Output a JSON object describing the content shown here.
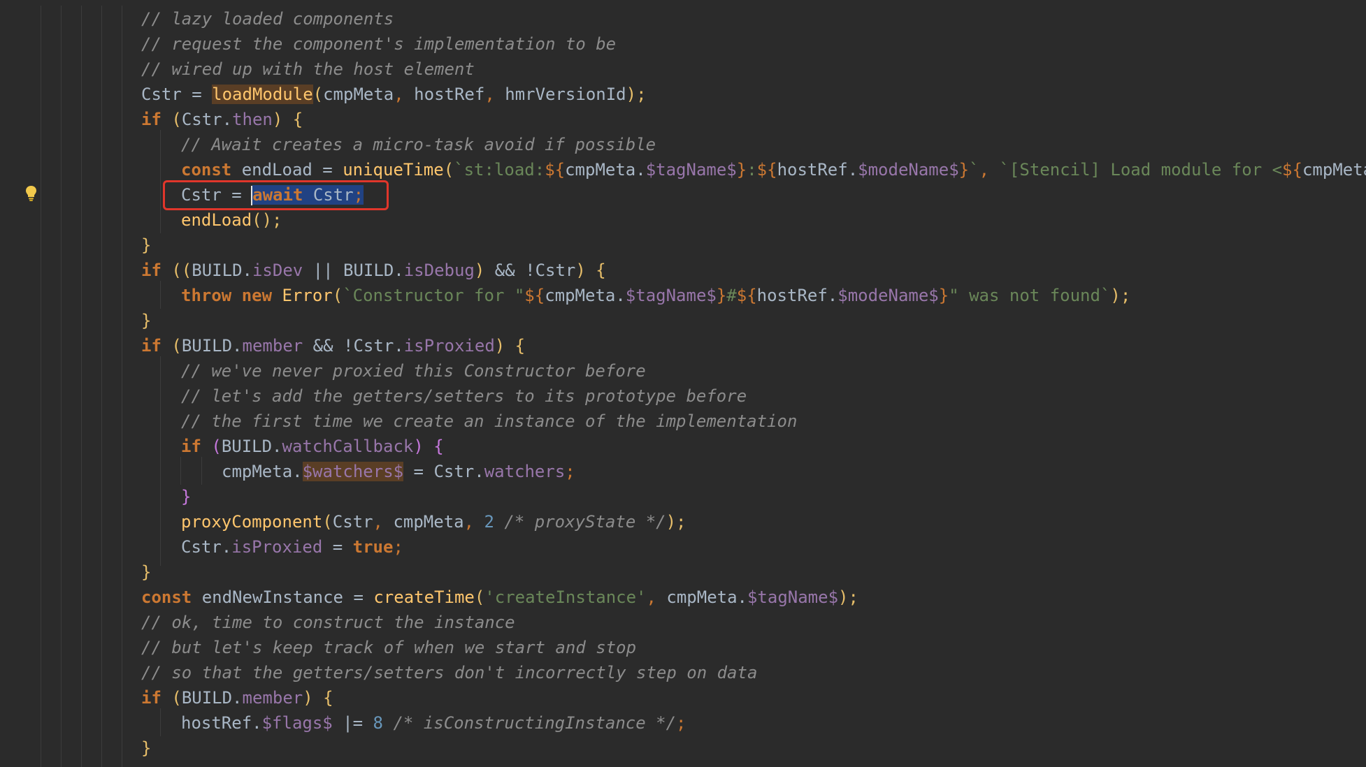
{
  "editor": {
    "gutter": {
      "lightbulb_icon": "lightbulb-icon"
    },
    "annotation": {
      "color": "#e0362b"
    },
    "lines": [
      {
        "tokens": [
          {
            "text": "// lazy loaded components",
            "cls": "c-comment"
          }
        ]
      },
      {
        "tokens": [
          {
            "text": "// request the component's implementation to be",
            "cls": "c-comment"
          }
        ]
      },
      {
        "tokens": [
          {
            "text": "// wired up with the host element",
            "cls": "c-comment"
          }
        ]
      },
      {
        "tokens": [
          {
            "text": "Cstr = ",
            "cls": "c-ident"
          },
          {
            "text": "loadModule",
            "cls": "c-func hl-func"
          },
          {
            "text": "(",
            "cls": "c-paren"
          },
          {
            "text": "cmpMeta",
            "cls": "c-ident"
          },
          {
            "text": ", ",
            "cls": "c-punct"
          },
          {
            "text": "hostRef",
            "cls": "c-ident"
          },
          {
            "text": ", ",
            "cls": "c-punct"
          },
          {
            "text": "hmrVersionId",
            "cls": "c-ident"
          },
          {
            "text": ");",
            "cls": "c-paren"
          }
        ]
      },
      {
        "tokens": [
          {
            "text": "if ",
            "cls": "c-keyword"
          },
          {
            "text": "(",
            "cls": "c-paren"
          },
          {
            "text": "Cstr.",
            "cls": "c-ident"
          },
          {
            "text": "then",
            "cls": "c-prop"
          },
          {
            "text": ") {",
            "cls": "c-paren"
          }
        ]
      },
      {
        "tokens": [
          {
            "text": "// Await creates a micro-task avoid if possible",
            "cls": "c-comment"
          }
        ]
      },
      {
        "tokens": [
          {
            "text": "const ",
            "cls": "c-keyword"
          },
          {
            "text": "endLoad = ",
            "cls": "c-ident"
          },
          {
            "text": "uniqueTime",
            "cls": "c-func"
          },
          {
            "text": "(",
            "cls": "c-paren"
          },
          {
            "text": "`st:load:",
            "cls": "c-string"
          },
          {
            "text": "${",
            "cls": "c-tpl"
          },
          {
            "text": "cmpMeta.",
            "cls": "c-ident"
          },
          {
            "text": "$tagName$",
            "cls": "c-prop"
          },
          {
            "text": "}",
            "cls": "c-tpl"
          },
          {
            "text": ":",
            "cls": "c-string"
          },
          {
            "text": "${",
            "cls": "c-tpl"
          },
          {
            "text": "hostRef.",
            "cls": "c-ident"
          },
          {
            "text": "$modeName$",
            "cls": "c-prop"
          },
          {
            "text": "}",
            "cls": "c-tpl"
          },
          {
            "text": "`",
            "cls": "c-string"
          },
          {
            "text": ", ",
            "cls": "c-punct"
          },
          {
            "text": "`[Stencil] Load module for <",
            "cls": "c-string"
          },
          {
            "text": "${",
            "cls": "c-tpl"
          },
          {
            "text": "cmpMeta",
            "cls": "c-ident"
          }
        ]
      },
      {
        "tokens": [
          {
            "text": "Cstr = ",
            "cls": "c-ident"
          },
          {
            "text": "|",
            "cls": "caret"
          },
          {
            "text": "await",
            "cls": "c-keyword hl-sel"
          },
          {
            "text": " Cstr",
            "cls": "c-ident hl-sel"
          },
          {
            "text": ";",
            "cls": "c-punct hl-sel"
          }
        ]
      },
      {
        "tokens": [
          {
            "text": "endLoad",
            "cls": "c-func"
          },
          {
            "text": "();",
            "cls": "c-paren"
          }
        ]
      },
      {
        "tokens": [
          {
            "text": "}",
            "cls": "c-paren"
          }
        ]
      },
      {
        "tokens": [
          {
            "text": "if ",
            "cls": "c-keyword"
          },
          {
            "text": "((",
            "cls": "c-paren"
          },
          {
            "text": "BUILD.",
            "cls": "c-ident"
          },
          {
            "text": "isDev",
            "cls": "c-prop"
          },
          {
            "text": " || ",
            "cls": "c-ident"
          },
          {
            "text": "BUILD.",
            "cls": "c-ident"
          },
          {
            "text": "isDebug",
            "cls": "c-prop"
          },
          {
            "text": ")",
            "cls": "c-paren"
          },
          {
            "text": " && !Cstr",
            "cls": "c-ident"
          },
          {
            "text": ") {",
            "cls": "c-paren"
          }
        ]
      },
      {
        "tokens": [
          {
            "text": "throw ",
            "cls": "c-keyword"
          },
          {
            "text": "new ",
            "cls": "c-keyword"
          },
          {
            "text": "Error",
            "cls": "c-func"
          },
          {
            "text": "(",
            "cls": "c-paren"
          },
          {
            "text": "`Constructor for \"",
            "cls": "c-string"
          },
          {
            "text": "${",
            "cls": "c-tpl"
          },
          {
            "text": "cmpMeta.",
            "cls": "c-ident"
          },
          {
            "text": "$tagName$",
            "cls": "c-prop"
          },
          {
            "text": "}",
            "cls": "c-tpl"
          },
          {
            "text": "#",
            "cls": "c-string"
          },
          {
            "text": "${",
            "cls": "c-tpl"
          },
          {
            "text": "hostRef.",
            "cls": "c-ident"
          },
          {
            "text": "$modeName$",
            "cls": "c-prop"
          },
          {
            "text": "}",
            "cls": "c-tpl"
          },
          {
            "text": "\" was not found`",
            "cls": "c-string"
          },
          {
            "text": ");",
            "cls": "c-paren"
          }
        ]
      },
      {
        "tokens": [
          {
            "text": "}",
            "cls": "c-paren"
          }
        ]
      },
      {
        "tokens": [
          {
            "text": "if ",
            "cls": "c-keyword"
          },
          {
            "text": "(",
            "cls": "c-paren"
          },
          {
            "text": "BUILD.",
            "cls": "c-ident"
          },
          {
            "text": "member",
            "cls": "c-prop"
          },
          {
            "text": " && !Cstr.",
            "cls": "c-ident"
          },
          {
            "text": "isProxied",
            "cls": "c-prop"
          },
          {
            "text": ") {",
            "cls": "c-paren"
          }
        ]
      },
      {
        "tokens": [
          {
            "text": "// we've never proxied this Constructor before",
            "cls": "c-comment"
          }
        ]
      },
      {
        "tokens": [
          {
            "text": "// let's add the getters/setters to its prototype before",
            "cls": "c-comment"
          }
        ]
      },
      {
        "tokens": [
          {
            "text": "// the first time we create an instance of the implementation",
            "cls": "c-comment"
          }
        ]
      },
      {
        "tokens": [
          {
            "text": "if ",
            "cls": "c-keyword"
          },
          {
            "text": "(",
            "cls": "c-bracket2"
          },
          {
            "text": "BUILD.",
            "cls": "c-ident"
          },
          {
            "text": "watchCallback",
            "cls": "c-prop"
          },
          {
            "text": ") {",
            "cls": "c-bracket2"
          }
        ]
      },
      {
        "tokens": [
          {
            "text": "cmpMeta.",
            "cls": "c-ident"
          },
          {
            "text": "$watchers$",
            "cls": "c-prop hl-func"
          },
          {
            "text": " = Cstr.",
            "cls": "c-ident"
          },
          {
            "text": "watchers",
            "cls": "c-prop"
          },
          {
            "text": ";",
            "cls": "c-punct"
          }
        ]
      },
      {
        "tokens": [
          {
            "text": "}",
            "cls": "c-bracket2"
          }
        ]
      },
      {
        "tokens": [
          {
            "text": "proxyComponent",
            "cls": "c-func"
          },
          {
            "text": "(",
            "cls": "c-paren"
          },
          {
            "text": "Cstr",
            "cls": "c-ident"
          },
          {
            "text": ", ",
            "cls": "c-punct"
          },
          {
            "text": "cmpMeta",
            "cls": "c-ident"
          },
          {
            "text": ", ",
            "cls": "c-punct"
          },
          {
            "text": "2 ",
            "cls": "c-number"
          },
          {
            "text": "/* proxyState */",
            "cls": "c-comment"
          },
          {
            "text": ");",
            "cls": "c-paren"
          }
        ]
      },
      {
        "tokens": [
          {
            "text": "Cstr.",
            "cls": "c-ident"
          },
          {
            "text": "isProxied",
            "cls": "c-prop"
          },
          {
            "text": " = ",
            "cls": "c-ident"
          },
          {
            "text": "true",
            "cls": "c-keyword"
          },
          {
            "text": ";",
            "cls": "c-punct"
          }
        ]
      },
      {
        "tokens": [
          {
            "text": "}",
            "cls": "c-paren"
          }
        ]
      },
      {
        "tokens": [
          {
            "text": "const ",
            "cls": "c-keyword"
          },
          {
            "text": "endNewInstance = ",
            "cls": "c-ident"
          },
          {
            "text": "createTime",
            "cls": "c-func"
          },
          {
            "text": "(",
            "cls": "c-paren"
          },
          {
            "text": "'createInstance'",
            "cls": "c-string"
          },
          {
            "text": ", ",
            "cls": "c-punct"
          },
          {
            "text": "cmpMeta.",
            "cls": "c-ident"
          },
          {
            "text": "$tagName$",
            "cls": "c-prop"
          },
          {
            "text": ");",
            "cls": "c-paren"
          }
        ]
      },
      {
        "tokens": [
          {
            "text": "// ok, time to construct the instance",
            "cls": "c-comment"
          }
        ]
      },
      {
        "tokens": [
          {
            "text": "// but let's keep track of when we start and stop",
            "cls": "c-comment"
          }
        ]
      },
      {
        "tokens": [
          {
            "text": "// so that the getters/setters don't incorrectly step on data",
            "cls": "c-comment"
          }
        ]
      },
      {
        "tokens": [
          {
            "text": "if ",
            "cls": "c-keyword"
          },
          {
            "text": "(",
            "cls": "c-paren"
          },
          {
            "text": "BUILD.",
            "cls": "c-ident"
          },
          {
            "text": "member",
            "cls": "c-prop"
          },
          {
            "text": ") {",
            "cls": "c-paren"
          }
        ]
      },
      {
        "tokens": [
          {
            "text": "hostRef.",
            "cls": "c-ident"
          },
          {
            "text": "$flags$",
            "cls": "c-prop"
          },
          {
            "text": " |= ",
            "cls": "c-ident"
          },
          {
            "text": "8 ",
            "cls": "c-number"
          },
          {
            "text": "/* isConstructingInstance */",
            "cls": "c-comment"
          },
          {
            "text": ";",
            "cls": "c-punct"
          }
        ]
      },
      {
        "tokens": [
          {
            "text": "}",
            "cls": "c-paren"
          }
        ]
      }
    ]
  }
}
